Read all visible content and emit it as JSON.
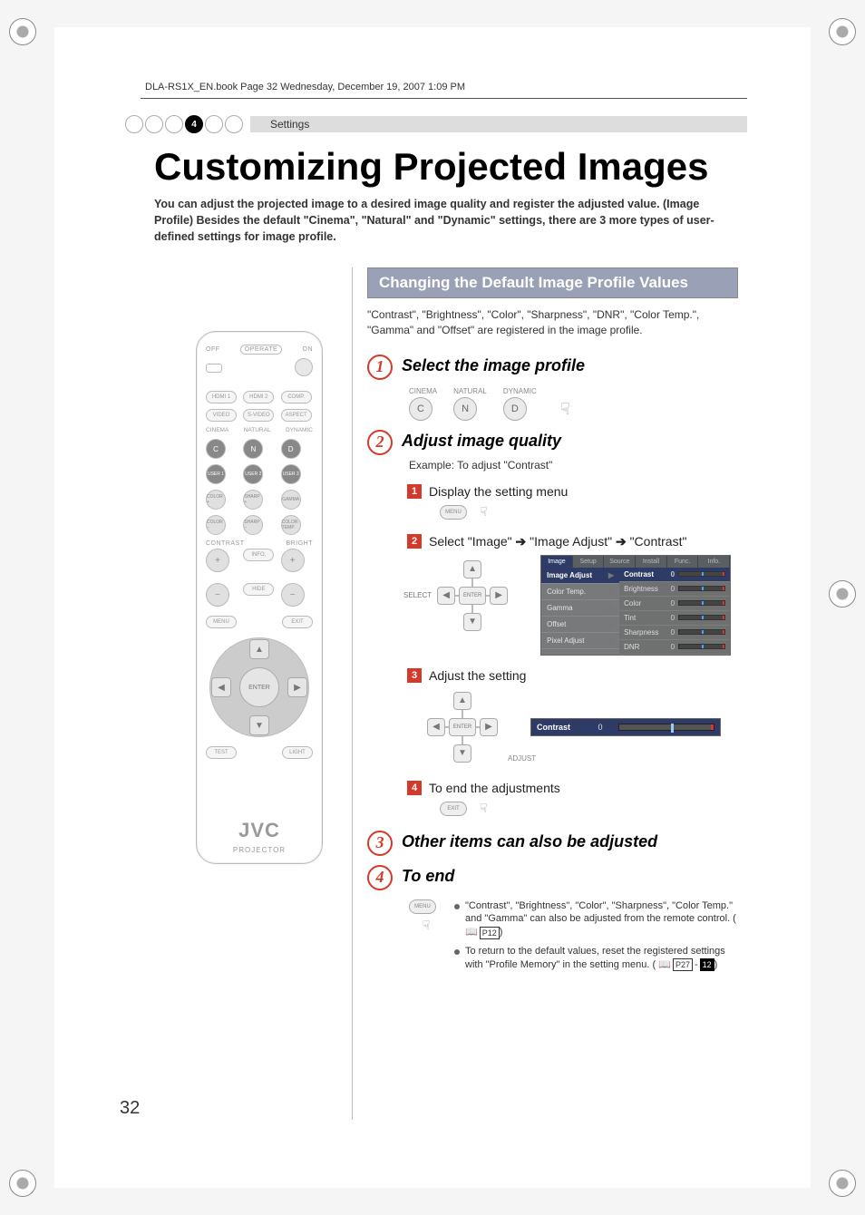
{
  "runhead": "DLA-RS1X_EN.book  Page 32  Wednesday, December 19, 2007  1:09 PM",
  "breadcrumb": {
    "active_index": "4",
    "label": "Settings"
  },
  "title": "Customizing Projected Images",
  "intro": "You can adjust the projected image to a desired image quality and register the adjusted value. (Image Profile)  Besides the default \"Cinema\", \"Natural\" and \"Dynamic\" settings, there are 3 more types of user-defined settings for image profile.",
  "remote": {
    "off": "OFF",
    "operate": "OPERATE",
    "on": "ON",
    "row1": [
      "HDMI 1",
      "HDMI 2",
      "COMP."
    ],
    "row2": [
      "VIDEO",
      "S-VIDEO",
      "ASPECT"
    ],
    "rowProfilesLbl": [
      "CINEMA",
      "NATURAL",
      "DYNAMIC"
    ],
    "rowProfiles": [
      "C",
      "N",
      "D"
    ],
    "rowUsers": [
      "USER 1",
      "USER 2",
      "USER 3"
    ],
    "rowAdj1": [
      "COLOR +",
      "SHARP +",
      "GAMMA"
    ],
    "rowAdj2": [
      "COLOR −",
      "SHARP −",
      "COLOR TEMP"
    ],
    "contrast": "CONTRAST",
    "bright": "BRIGHT",
    "info": "INFO.",
    "hide": "HIDE",
    "menu": "MENU",
    "exit": "EXIT",
    "enter": "ENTER",
    "test": "TEST",
    "light": "LIGHT",
    "brand": "JVC",
    "model": "PROJECTOR"
  },
  "section_bar": "Changing the Default Image Profile Values",
  "section_note": "\"Contrast\", \"Brightness\", \"Color\", \"Sharpness\", \"DNR\", \"Color Temp.\", \"Gamma\" and \"Offset\" are registered in the image profile.",
  "steps": {
    "s1": {
      "title": "Select the image profile",
      "profiles": [
        {
          "lbl": "CINEMA",
          "btn": "C"
        },
        {
          "lbl": "NATURAL",
          "btn": "N"
        },
        {
          "lbl": "DYNAMIC",
          "btn": "D"
        }
      ]
    },
    "s2": {
      "title": "Adjust image quality",
      "example": "Example: To adjust \"Contrast\"",
      "sub1": "Display the setting menu",
      "menu_btn": "MENU",
      "sub2_a": "Select \"Image\"",
      "sub2_b": "\"Image Adjust\"",
      "sub2_c": "\"Contrast\"",
      "select_lbl": "SELECT",
      "enter": "ENTER",
      "sub3": "Adjust the setting",
      "adjust_lbl": "ADJUST",
      "sub4": "To end the adjustments",
      "exit_btn": "EXIT"
    },
    "s3": {
      "title": "Other items can also be adjusted"
    },
    "s4": {
      "title": "To end",
      "menu_btn": "MENU",
      "bullet1": "\"Contrast\", \"Brightness\", \"Color\", \"Sharpness\", \"Color Temp.\" and \"Gamma\" can also be adjusted from the remote control. (",
      "bullet1_ref": "P12",
      "bullet1_tail": ")",
      "bullet2": "To return to the default values, reset the registered settings with \"Profile Memory\" in the setting menu. (",
      "bullet2_ref": "P27",
      "bullet2_box": "12",
      "bullet2_tail": ")"
    }
  },
  "osd": {
    "tabs": [
      "Image",
      "Setup",
      "Source",
      "Install",
      "Func.",
      "Info."
    ],
    "left": [
      "Image Adjust",
      "Color Temp.",
      "Gamma",
      "Offset",
      "Pixel Adjust"
    ],
    "right": [
      {
        "nm": "Contrast",
        "val": "0"
      },
      {
        "nm": "Brightness",
        "val": "0"
      },
      {
        "nm": "Color",
        "val": "0"
      },
      {
        "nm": "Tint",
        "val": "0"
      },
      {
        "nm": "Sharpness",
        "val": "0"
      },
      {
        "nm": "DNR",
        "val": "0"
      }
    ]
  },
  "contrast_box": {
    "nm": "Contrast",
    "val": "0"
  },
  "page_number": "32"
}
